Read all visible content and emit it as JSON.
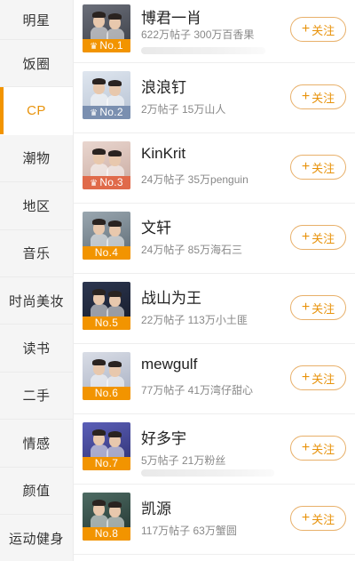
{
  "sidebar": {
    "items": [
      {
        "label": "明星"
      },
      {
        "label": "饭圈"
      },
      {
        "label": "CP",
        "active": true
      },
      {
        "label": "潮物"
      },
      {
        "label": "地区"
      },
      {
        "label": "音乐"
      },
      {
        "label": "时尚美妆"
      },
      {
        "label": "读书"
      },
      {
        "label": "二手"
      },
      {
        "label": "情感"
      },
      {
        "label": "颜值"
      },
      {
        "label": "运动健身"
      }
    ]
  },
  "ranking": {
    "follow_label": "关注",
    "plus_glyph": "+",
    "items": [
      {
        "rank": "No.1",
        "name": "博君一肖",
        "stats": "622万帖子 300万百香果",
        "badge_color": "#f29400",
        "crown": "♛",
        "thumb_colors": [
          "#6b6f7a",
          "#3a3d45"
        ]
      },
      {
        "rank": "No.2",
        "name": "浪浪钉",
        "stats": "2万帖子 15万山人",
        "badge_color": "#7a8fb0",
        "crown": "♛",
        "thumb_colors": [
          "#dfe6ef",
          "#b6c2d3"
        ]
      },
      {
        "rank": "No.3",
        "name": "KinKrit",
        "stats": "24万帖子 35万penguin",
        "badge_color": "#e06a4a",
        "crown": "♛",
        "thumb_colors": [
          "#e9d6cf",
          "#c9aaa0"
        ]
      },
      {
        "rank": "No.4",
        "name": "文轩",
        "stats": "24万帖子 85万海石三",
        "badge_color": "#f29400",
        "crown": "",
        "thumb_colors": [
          "#9aa7b0",
          "#5d6a74"
        ]
      },
      {
        "rank": "No.5",
        "name": "战山为王",
        "stats": "22万帖子 113万小土匪",
        "badge_color": "#f29400",
        "crown": "",
        "thumb_colors": [
          "#2c3650",
          "#161b29"
        ]
      },
      {
        "rank": "No.6",
        "name": "mewgulf",
        "stats": "77万帖子 41万湾仔甜心",
        "badge_color": "#f29400",
        "crown": "",
        "thumb_colors": [
          "#d9dde6",
          "#a7afc2"
        ]
      },
      {
        "rank": "No.7",
        "name": "好多宇",
        "stats": "5万帖子 21万粉丝",
        "badge_color": "#f29400",
        "crown": "",
        "thumb_colors": [
          "#5b5fb8",
          "#2e3070"
        ]
      },
      {
        "rank": "No.8",
        "name": "凯源",
        "stats": "117万帖子 63万蟹圆",
        "badge_color": "#f29400",
        "crown": "",
        "thumb_colors": [
          "#4d6b63",
          "#22342f"
        ]
      }
    ]
  }
}
